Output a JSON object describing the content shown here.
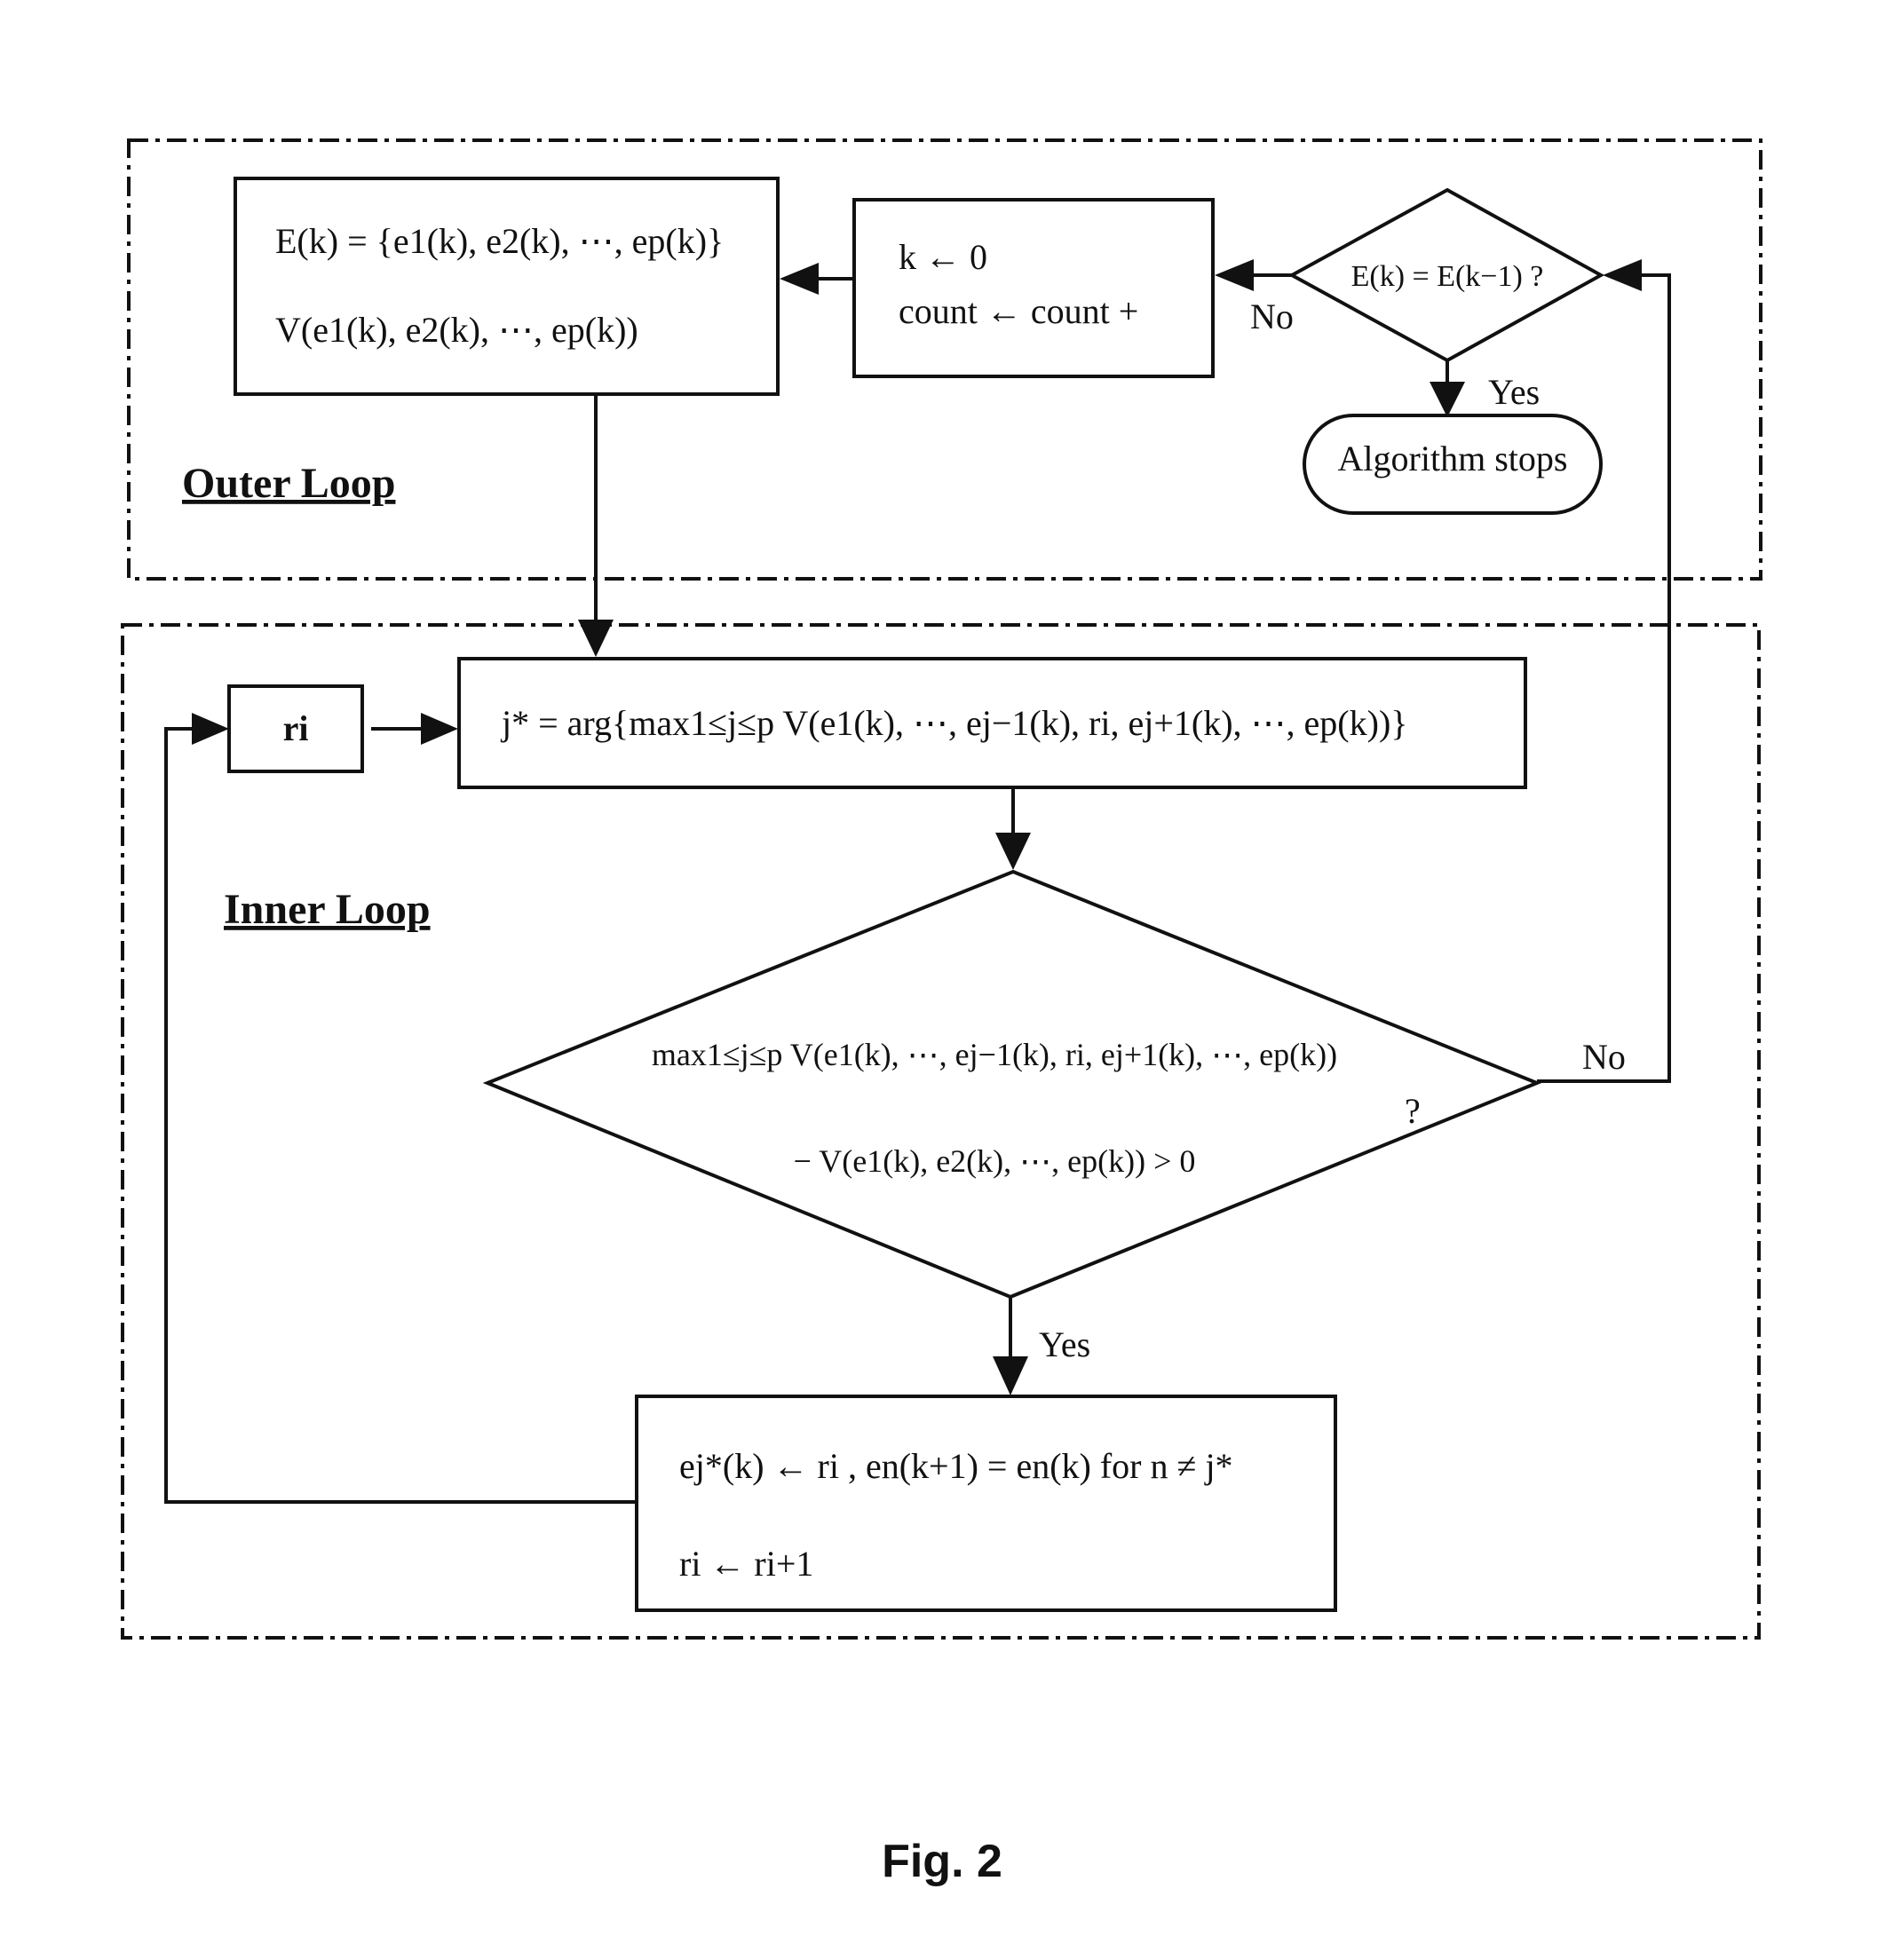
{
  "figure": {
    "caption": "Fig. 2",
    "regions": {
      "outer": "Outer Loop",
      "inner": "Inner Loop"
    },
    "nodes": {
      "e_set": {
        "line1": "E(k) = {e1(k), e2(k), ⋯, ep(k)}",
        "line2": "V(e1(k), e2(k), ⋯, ep(k))"
      },
      "init": {
        "line1": "k ← 0",
        "line2": "count ← count +"
      },
      "converged": {
        "text": "E(k) = E(k−1) ?"
      },
      "stop": {
        "text": "Algorithm stops"
      },
      "ri": {
        "text": "ri"
      },
      "argmax": {
        "text": "j* = arg{max1≤j≤p V(e1(k), ⋯, ej−1(k), ri, ej+1(k), ⋯, ep(k))}"
      },
      "improve": {
        "line1": "max1≤j≤p V(e1(k), ⋯, ej−1(k), ri, ej+1(k), ⋯, ep(k))",
        "line2": "− V(e1(k), e2(k), ⋯, ep(k)) > 0",
        "question": "?"
      },
      "update": {
        "line1": "ej*(k) ← ri , en(k+1) = en(k) for n ≠ j*",
        "line2": "ri ← ri+1"
      }
    },
    "edge_labels": {
      "converged_no": "No",
      "converged_yes": "Yes",
      "improve_no": "No",
      "improve_yes": "Yes"
    }
  }
}
